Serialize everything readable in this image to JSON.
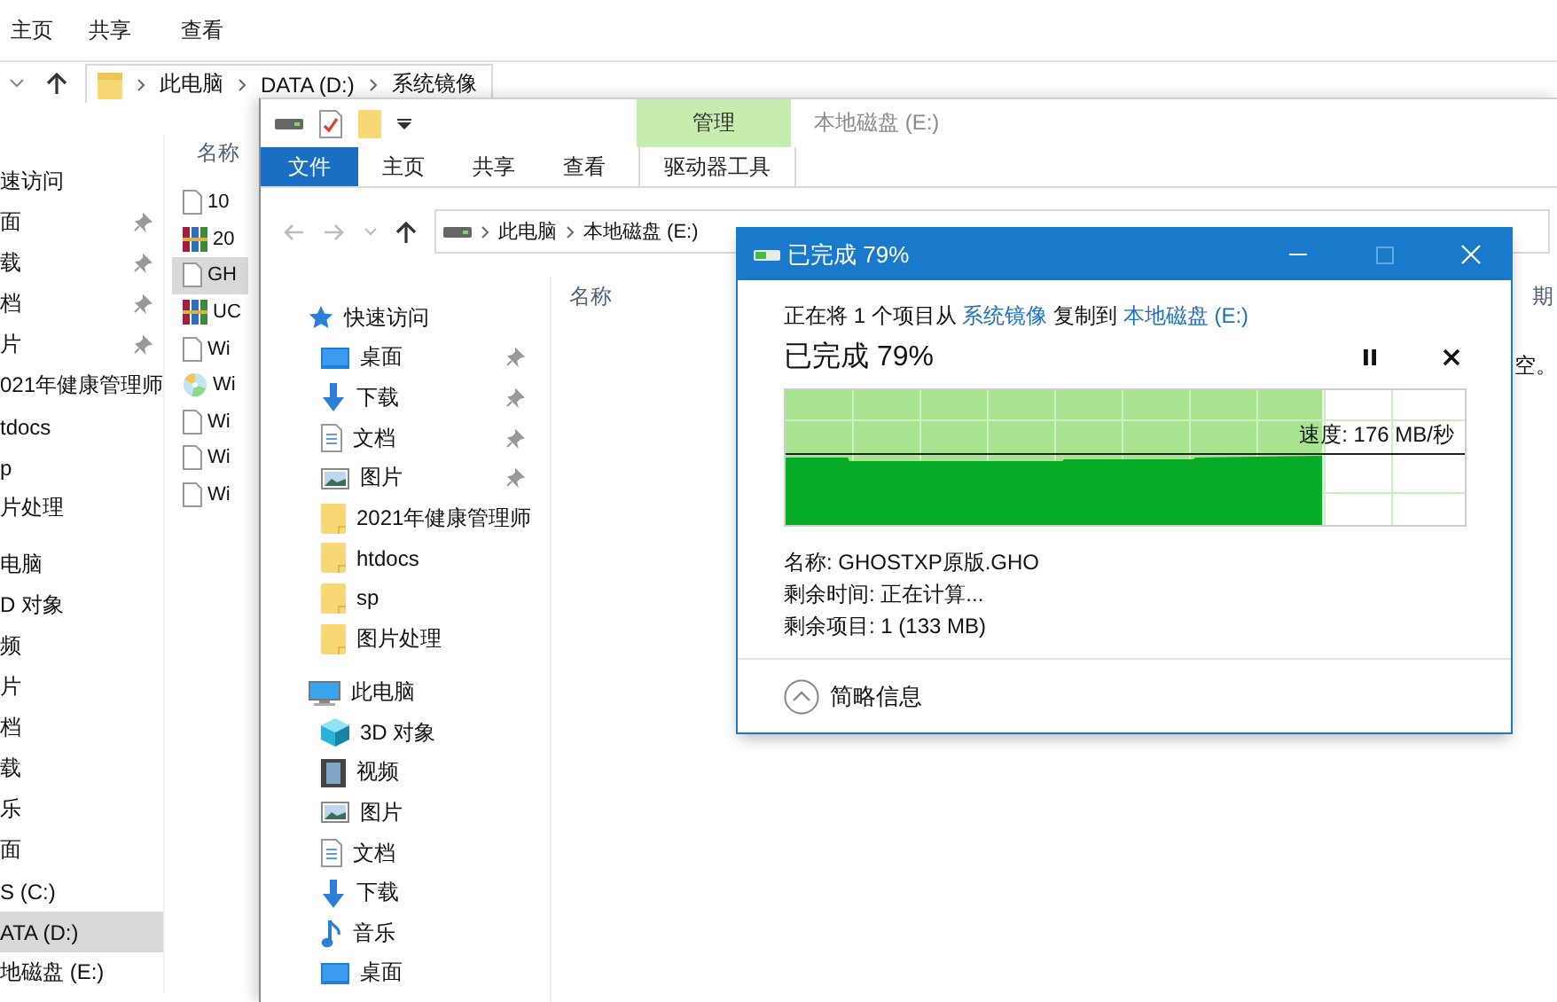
{
  "back_window": {
    "ribbon_tabs": [
      "主页",
      "共享",
      "查看"
    ],
    "address": [
      "此电脑",
      "DATA (D:)",
      "系统镜像"
    ],
    "nav_items": [
      {
        "label": "速访问",
        "kind": "section",
        "pinned": false,
        "selected": false
      },
      {
        "label": "面",
        "kind": "item",
        "pinned": true,
        "selected": false
      },
      {
        "label": "载",
        "kind": "item",
        "pinned": true,
        "selected": false
      },
      {
        "label": "档",
        "kind": "item",
        "pinned": true,
        "selected": false
      },
      {
        "label": "片",
        "kind": "item",
        "pinned": true,
        "selected": false
      },
      {
        "label": "021年健康管理师",
        "kind": "item",
        "pinned": false,
        "selected": false
      },
      {
        "label": "tdocs",
        "kind": "item",
        "pinned": false,
        "selected": false
      },
      {
        "label": "p",
        "kind": "item",
        "pinned": false,
        "selected": false
      },
      {
        "label": "片处理",
        "kind": "item",
        "pinned": false,
        "selected": false
      },
      {
        "label": "电脑",
        "kind": "section",
        "pinned": false,
        "selected": false
      },
      {
        "label": "D 对象",
        "kind": "item",
        "pinned": false,
        "selected": false
      },
      {
        "label": "频",
        "kind": "item",
        "pinned": false,
        "selected": false
      },
      {
        "label": "片",
        "kind": "item",
        "pinned": false,
        "selected": false
      },
      {
        "label": "档",
        "kind": "item",
        "pinned": false,
        "selected": false
      },
      {
        "label": "载",
        "kind": "item",
        "pinned": false,
        "selected": false
      },
      {
        "label": "乐",
        "kind": "item",
        "pinned": false,
        "selected": false
      },
      {
        "label": "面",
        "kind": "item",
        "pinned": false,
        "selected": false
      },
      {
        "label": "S (C:)",
        "kind": "item",
        "pinned": false,
        "selected": false
      },
      {
        "label": "ATA (D:)",
        "kind": "item",
        "pinned": false,
        "selected": true
      },
      {
        "label": "地磁盘 (E:)",
        "kind": "item",
        "pinned": false,
        "selected": false
      }
    ],
    "column": "名称",
    "files": [
      {
        "name": "10",
        "kind": "doc",
        "selected": false
      },
      {
        "name": "20",
        "kind": "archive",
        "selected": false
      },
      {
        "name": "GH",
        "kind": "doc",
        "selected": true
      },
      {
        "name": "UC",
        "kind": "archive",
        "selected": false
      },
      {
        "name": "Wi",
        "kind": "doc",
        "selected": false
      },
      {
        "name": "Wi",
        "kind": "disc",
        "selected": false
      },
      {
        "name": "Wi",
        "kind": "doc",
        "selected": false
      },
      {
        "name": "Wi",
        "kind": "doc",
        "selected": false
      },
      {
        "name": "Wi",
        "kind": "doc",
        "selected": false
      }
    ]
  },
  "front_window": {
    "context_tab": "管理",
    "title": "本地磁盘 (E:)",
    "ribbon_tabs": [
      {
        "label": "文件",
        "kind": "file"
      },
      {
        "label": "主页",
        "kind": "tab"
      },
      {
        "label": "共享",
        "kind": "tab"
      },
      {
        "label": "查看",
        "kind": "tab"
      },
      {
        "label": "驱动器工具",
        "kind": "context"
      }
    ],
    "address": [
      "此电脑",
      "本地磁盘 (E:)"
    ],
    "nav_items": [
      {
        "label": "快速访问",
        "kind": "quick",
        "pinned": false
      },
      {
        "label": "桌面",
        "kind": "desktop",
        "pinned": true
      },
      {
        "label": "下载",
        "kind": "download",
        "pinned": true
      },
      {
        "label": "文档",
        "kind": "docs",
        "pinned": true
      },
      {
        "label": "图片",
        "kind": "pictures",
        "pinned": true
      },
      {
        "label": "2021年健康管理师",
        "kind": "folder",
        "pinned": false
      },
      {
        "label": "htdocs",
        "kind": "folder",
        "pinned": false
      },
      {
        "label": "sp",
        "kind": "folder",
        "pinned": false
      },
      {
        "label": "图片处理",
        "kind": "folder",
        "pinned": false
      },
      {
        "label": "此电脑",
        "kind": "pc",
        "pinned": false
      },
      {
        "label": "3D 对象",
        "kind": "cube",
        "pinned": false
      },
      {
        "label": "视频",
        "kind": "video",
        "pinned": false
      },
      {
        "label": "图片",
        "kind": "pictures",
        "pinned": false
      },
      {
        "label": "文档",
        "kind": "docs",
        "pinned": false
      },
      {
        "label": "下载",
        "kind": "download",
        "pinned": false
      },
      {
        "label": "音乐",
        "kind": "music",
        "pinned": false
      },
      {
        "label": "桌面",
        "kind": "desktop",
        "pinned": false
      }
    ],
    "column": "名称",
    "column_2": "期",
    "empty_message": "空。"
  },
  "dialog": {
    "title": "已完成 79%",
    "maximize_disabled": true,
    "message": {
      "prefix": "正在将 1 个项目从",
      "source": "系统镜像",
      "middle": "复制到",
      "target": "本地磁盘 (E:)"
    },
    "status": "已完成 79%",
    "level": 0.79,
    "speed": "速度: 176 MB/秒",
    "details": [
      "名称: GHOSTXP原版.GHO",
      "剩余时间: 正在计算...",
      "剩余项目: 1 (133 MB)"
    ],
    "toggle": "简略信息"
  }
}
